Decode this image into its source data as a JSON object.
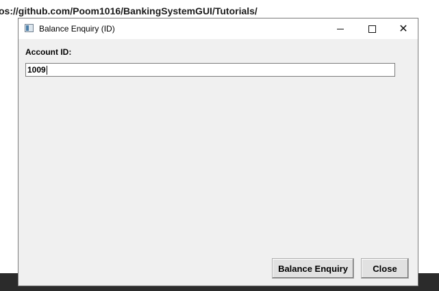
{
  "background": {
    "url_text": "os://github.com/Poom1016/BankingSystemGUI/Tutorials/"
  },
  "window": {
    "title": "Balance Enquiry (ID)",
    "controls": {
      "minimize": "minimize",
      "maximize": "maximize",
      "close": "✕"
    }
  },
  "form": {
    "account_label": "Account ID:",
    "account_value": "1009"
  },
  "buttons": {
    "enquiry_label": "Balance Enquiry",
    "close_label": "Close"
  }
}
